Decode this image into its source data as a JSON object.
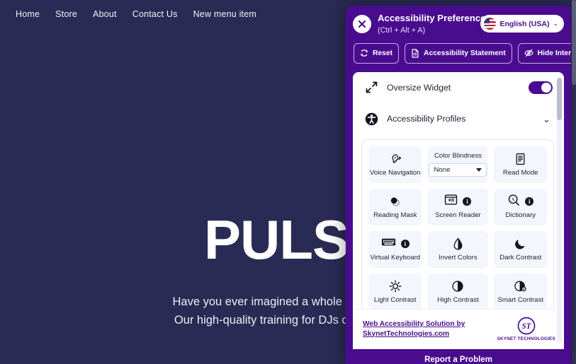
{
  "site": {
    "nav": [
      {
        "label": "Home"
      },
      {
        "label": "Store"
      },
      {
        "label": "About"
      },
      {
        "label": "Contact Us"
      },
      {
        "label": "New menu item"
      }
    ],
    "hero": {
      "title": "PULSE",
      "line1": "Have you ever imagined a whole dance floor m",
      "line2": "Our high-quality training for DJs can make you"
    }
  },
  "widget": {
    "header": {
      "title": "Accessibility Preferences",
      "subtitle": "(Ctrl + Alt + A)",
      "close_label": "Close",
      "language": "English (USA)",
      "language_caret": "⌄"
    },
    "actions": [
      {
        "label": "Reset",
        "icon": "reset-icon"
      },
      {
        "label": "Accessibility Statement",
        "icon": "document-icon"
      },
      {
        "label": "Hide Interface",
        "icon": "eye-off-icon"
      }
    ],
    "rows": [
      {
        "label": "Oversize Widget",
        "icon": "expand-icon",
        "control": "toggle",
        "toggle_on": true
      },
      {
        "label": "Accessibility Profiles",
        "icon": "accessibility-person-icon",
        "control": "chevron",
        "chevron": "⌄"
      }
    ],
    "tiles": [
      {
        "label": "Voice Navigation",
        "icon": "voice-navigation-icon",
        "type": "tile",
        "info": false
      },
      {
        "label": "Color Blindness",
        "icon": "none",
        "type": "select",
        "value": "None"
      },
      {
        "label": "Read Mode",
        "icon": "read-mode-icon",
        "type": "tile",
        "info": false
      },
      {
        "label": "Reading Mask",
        "icon": "reading-mask-icon",
        "type": "tile",
        "info": false
      },
      {
        "label": "Screen Reader",
        "icon": "screen-reader-icon",
        "type": "tile",
        "info": true
      },
      {
        "label": "Dictionary",
        "icon": "dictionary-icon",
        "type": "tile",
        "info": true
      },
      {
        "label": "Virtual Keyboard",
        "icon": "virtual-keyboard-icon",
        "type": "tile",
        "info": true
      },
      {
        "label": "Invert Colors",
        "icon": "invert-colors-icon",
        "type": "tile",
        "info": false
      },
      {
        "label": "Dark Contrast",
        "icon": "dark-contrast-icon",
        "type": "tile",
        "info": false
      },
      {
        "label": "Light Contrast",
        "icon": "light-contrast-icon",
        "type": "tile",
        "info": false
      },
      {
        "label": "High Contrast",
        "icon": "high-contrast-icon",
        "type": "tile",
        "info": false
      },
      {
        "label": "Smart Contrast",
        "icon": "smart-contrast-icon",
        "type": "tile",
        "info": false
      }
    ],
    "info_badge_glyph": "i",
    "footer": {
      "link_line1": "Web Accessibility Solution by",
      "link_line2": "SkynetTechnologies.com",
      "logo_mark": "ST",
      "logo_name": "SKYNET TECHNOLOGIES"
    },
    "report": {
      "label": "Report a Problem"
    }
  },
  "colors": {
    "page_bg": "#2a2b55",
    "panel_purple": "#4a0c8f",
    "tile_bg": "#f3f6fc",
    "accent_link": "#4a0c8f"
  }
}
